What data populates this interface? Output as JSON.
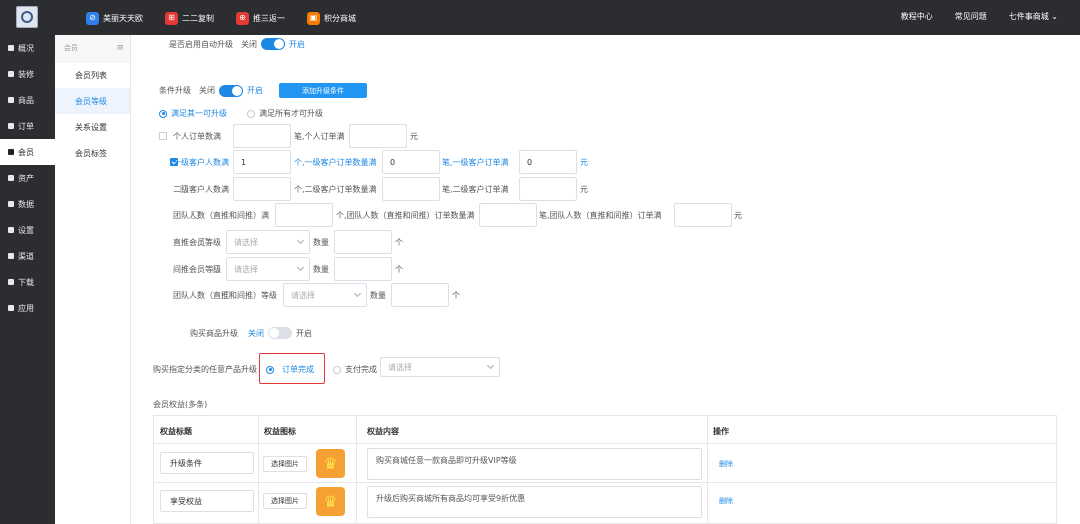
{
  "topnav": {
    "items": [
      {
        "label": "美丽天天欧",
        "color": "#2f80ed",
        "glyph": "⊘"
      },
      {
        "label": "二二复制",
        "color": "#e53935",
        "glyph": "⊞"
      },
      {
        "label": "推三返一",
        "color": "#e53935",
        "glyph": "⊕"
      },
      {
        "label": "积分商城",
        "color": "#f57c00",
        "glyph": "▣"
      }
    ],
    "right": [
      "教程中心",
      "常见问题",
      "七件事商城 ⌄"
    ]
  },
  "sidebar": {
    "items": [
      "概况",
      "装修",
      "商品",
      "订单",
      "会员",
      "资产",
      "数据",
      "设置",
      "渠道",
      "下载",
      "应用"
    ],
    "active": 4
  },
  "subnav": {
    "header": "会员",
    "items": [
      "会员列表",
      "会员等级",
      "关系设置",
      "会员标签"
    ],
    "active": 1
  },
  "form": {
    "auto_upgrade_label": "是否启用自动升级",
    "off": "关闭",
    "on": "开启",
    "cond_label": "条件升级",
    "add_cond_button": "添加升级条件",
    "radio_any": "满足其一可升级",
    "radio_all": "满足所有才可升级",
    "row1": {
      "a": "个人订单数满",
      "b": "笔,个人订单满",
      "c": "元",
      "v1": "",
      "v2": ""
    },
    "row2": {
      "a": "一级客户人数满",
      "b": "个,一级客户订单数量满",
      "c": "笔,一级客户订单满",
      "d": "元",
      "v1": "1",
      "v2": "0",
      "v3": "0"
    },
    "row3": {
      "a": "二级客户人数满",
      "b": "个,二级客户订单数量满",
      "c": "笔,二级客户订单满",
      "d": "元"
    },
    "row4": {
      "a": "团队人数（直推和间推）满",
      "b": "个,团队人数（直推和间推）订单数量满",
      "c": "笔,团队人数（直推和间推）订单满",
      "d": "元"
    },
    "row5": {
      "a": "直推会员等级",
      "placeholder": "请选择",
      "b": "数量",
      "c": "个"
    },
    "row6": {
      "a": "间推会员等级",
      "placeholder": "请选择",
      "b": "数量",
      "c": "个"
    },
    "row7": {
      "a": "团队人数（直推和间推）等级",
      "placeholder": "请选择",
      "b": "数量",
      "c": "个"
    },
    "buy_label": "购买商品升级",
    "buy_cat_label": "购买指定分类的任意产品升级",
    "order_done": "订单完成",
    "pay_done": "支付完成",
    "pay_placeholder": "请选择"
  },
  "benefits": {
    "title": "会员权益(多条)",
    "headers": [
      "权益标题",
      "权益图标",
      "权益内容",
      "操作"
    ],
    "rows": [
      {
        "title": "升级条件",
        "select": "选择图片",
        "content": "购买商城任意一款商品即可升级VIP等级",
        "action": "删除"
      },
      {
        "title": "享受权益",
        "select": "选择图片",
        "content": "升级后购买商城所有商品均可享受9折优惠",
        "action": "删除"
      }
    ]
  }
}
